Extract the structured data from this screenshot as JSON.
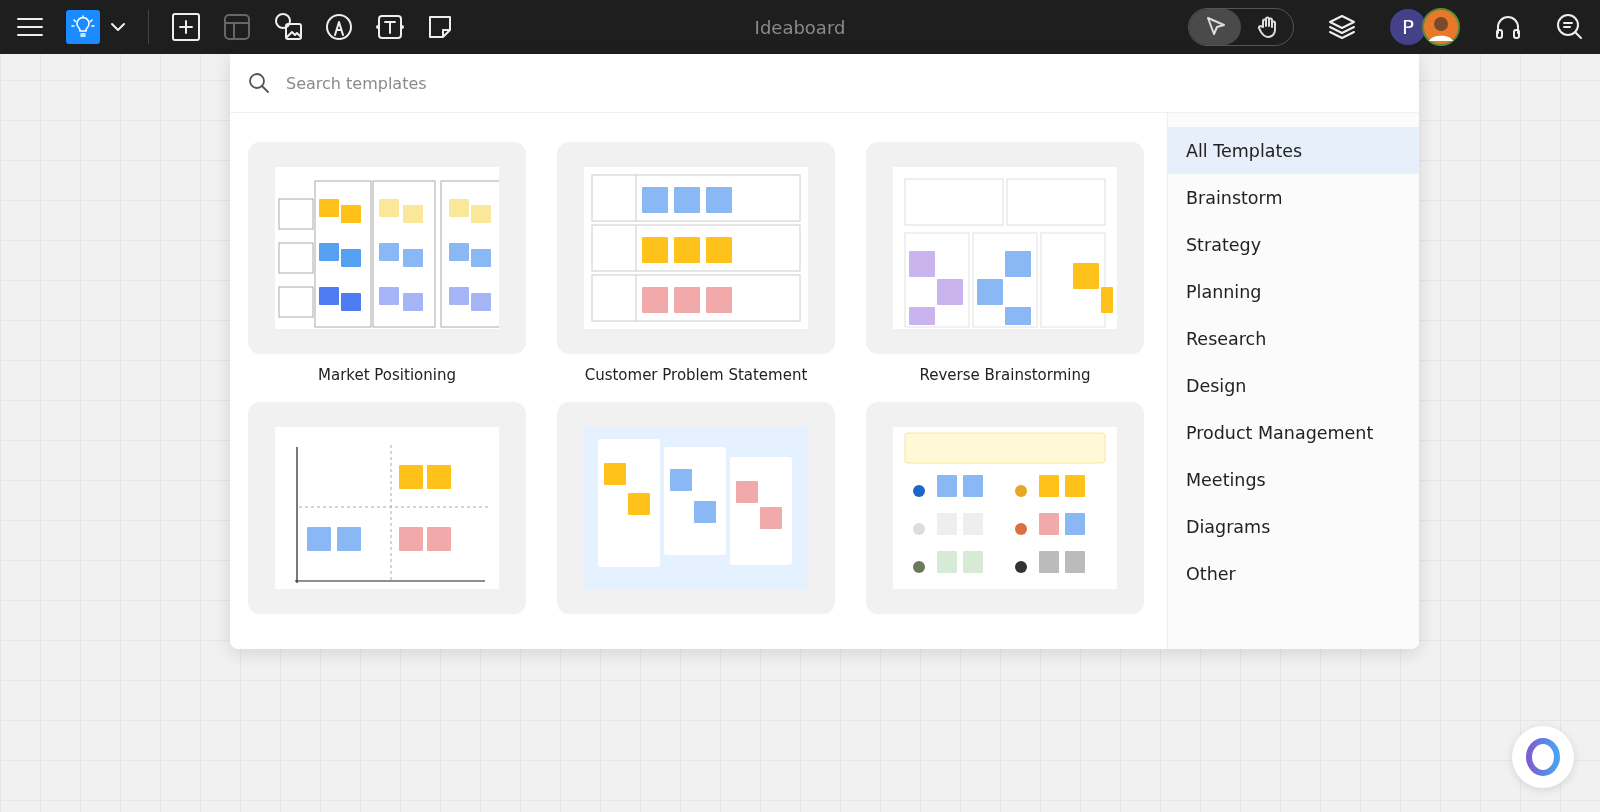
{
  "toolbar": {
    "title": "Ideaboard",
    "tools": [
      {
        "kind": "pointer",
        "selected": true
      },
      {
        "kind": "hand",
        "selected": false
      }
    ],
    "avatar_letter": "P"
  },
  "search": {
    "placeholder": "Search templates"
  },
  "templates": [
    {
      "name": "Market Positioning",
      "kind": "columns"
    },
    {
      "name": "Customer Problem Statement",
      "kind": "rows"
    },
    {
      "name": "Reverse Brainstorming",
      "kind": "reverse"
    },
    {
      "kind": "quadrant"
    },
    {
      "kind": "funnel"
    },
    {
      "kind": "hats"
    }
  ],
  "categories": [
    {
      "label": "All Templates",
      "selected": true
    },
    {
      "label": "Brainstorm",
      "selected": false
    },
    {
      "label": "Strategy",
      "selected": false
    },
    {
      "label": "Planning",
      "selected": false
    },
    {
      "label": "Research",
      "selected": false
    },
    {
      "label": "Design",
      "selected": false
    },
    {
      "label": "Product Management",
      "selected": false
    },
    {
      "label": "Meetings",
      "selected": false
    },
    {
      "label": "Diagrams",
      "selected": false
    },
    {
      "label": "Other",
      "selected": false
    }
  ]
}
